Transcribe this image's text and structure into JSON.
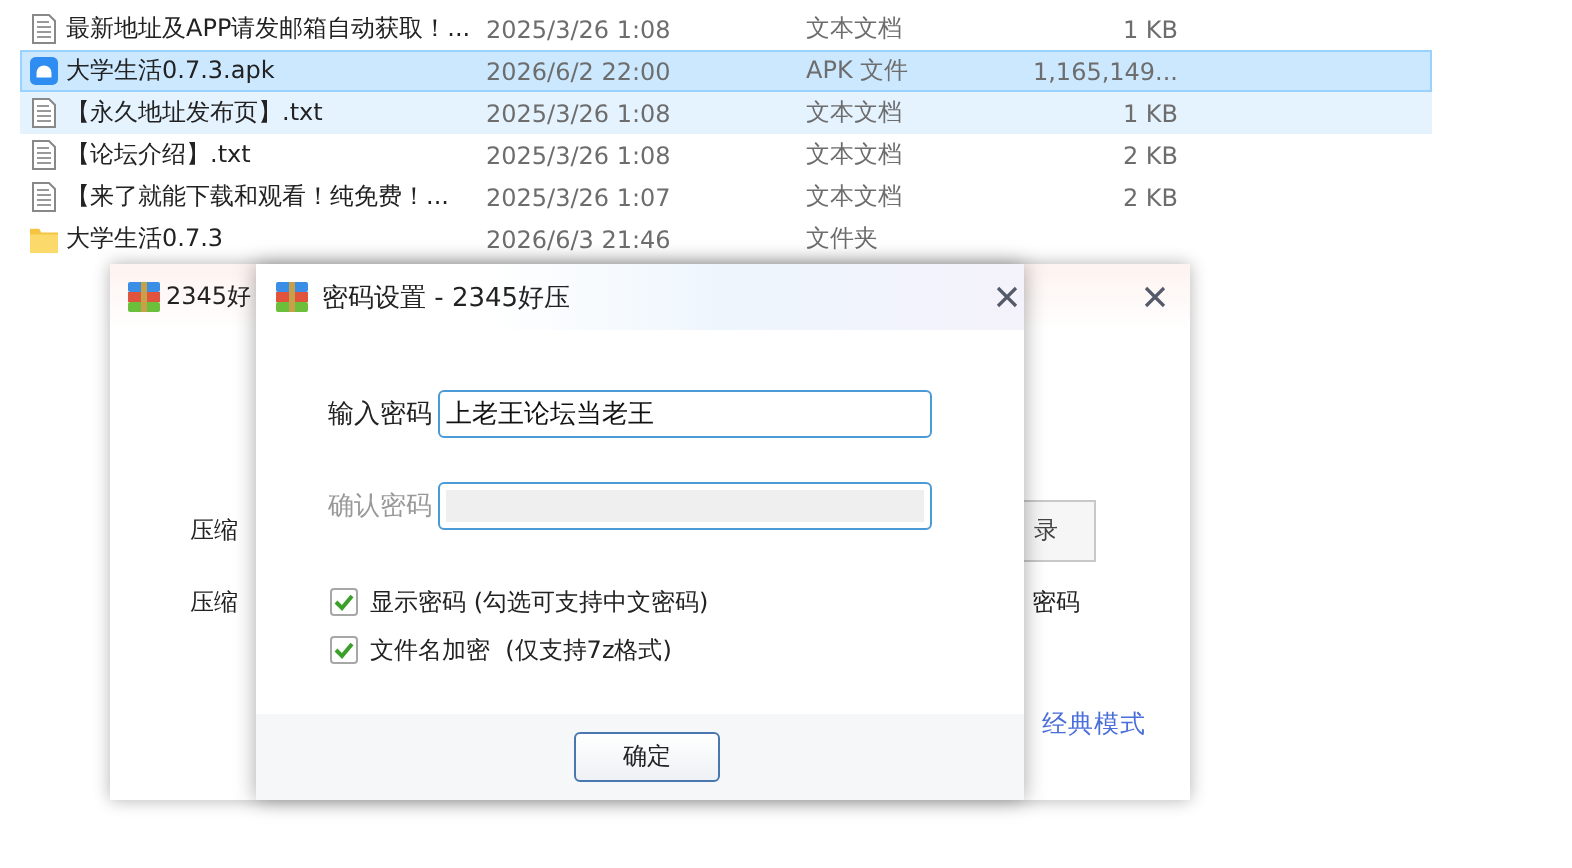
{
  "file_list": {
    "rows": [
      {
        "kind": "text",
        "name": "最新地址及APP请发邮箱自动获取！...",
        "modified": "2025/3/26 1:08",
        "type": "文本文档",
        "size": "1 KB",
        "selected": false,
        "hover": false
      },
      {
        "kind": "apk",
        "name": "大学生活0.7.3.apk",
        "modified": "2026/6/2 22:00",
        "type": "APK 文件",
        "size": "1,165,149...",
        "selected": true,
        "hover": false
      },
      {
        "kind": "text",
        "name": "【永久地址发布页】.txt",
        "modified": "2025/3/26 1:08",
        "type": "文本文档",
        "size": "1 KB",
        "selected": false,
        "hover": true
      },
      {
        "kind": "text",
        "name": "【论坛介绍】.txt",
        "modified": "2025/3/26 1:08",
        "type": "文本文档",
        "size": "2 KB",
        "selected": false,
        "hover": false
      },
      {
        "kind": "text",
        "name": "【来了就能下载和观看！纯免费！...",
        "modified": "2025/3/26 1:07",
        "type": "文本文档",
        "size": "2 KB",
        "selected": false,
        "hover": false
      },
      {
        "kind": "folder",
        "name": "大学生活0.7.3",
        "modified": "2026/6/3 21:46",
        "type": "文件夹",
        "selected": false,
        "hover": false
      }
    ]
  },
  "background_window": {
    "title": "2345好",
    "label_1": "压缩",
    "button": "录",
    "label_2": "压缩",
    "right_label": "密码",
    "link": "经典模式"
  },
  "dialog": {
    "title": "密码设置 - 2345好压",
    "password_label": "输入密码",
    "password_value": "上老王论坛当老王",
    "confirm_label": "确认密码",
    "confirm_disabled": true,
    "options": [
      {
        "label": "显示密码 (勾选可支持中文密码)",
        "checked": true
      },
      {
        "label": "文件名加密  (仅支持7z格式)",
        "checked": true
      }
    ],
    "ok_button": "确定"
  }
}
